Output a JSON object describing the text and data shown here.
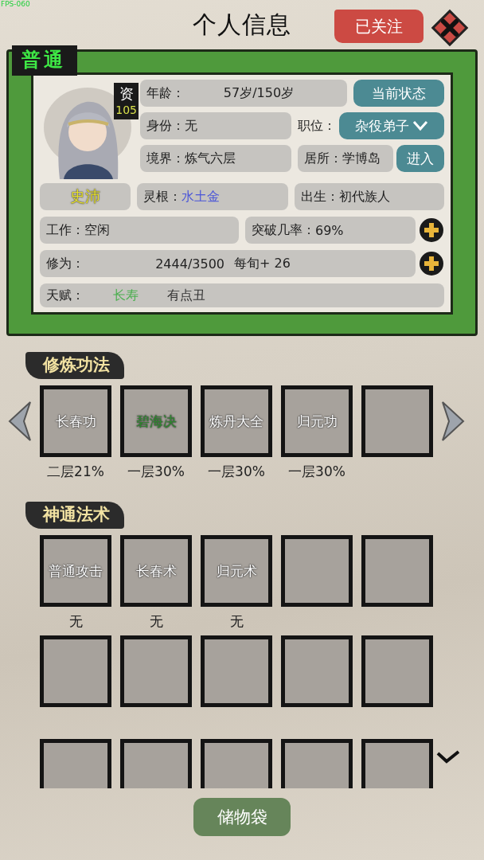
{
  "fps": "FPS-060",
  "title": "个人信息",
  "follow_button": "已关注",
  "rank": "普通",
  "aptitude": {
    "label": "资",
    "value": "105"
  },
  "name": "史沛",
  "age": {
    "label": "年龄：",
    "value": "57岁/150岁"
  },
  "status_button": "当前状态",
  "identity": {
    "label": "身份：",
    "value": "无"
  },
  "position": {
    "label": "职位：",
    "value": "杂役弟子"
  },
  "realm": {
    "label": "境界：",
    "value": "炼气六层"
  },
  "residence": {
    "label": "居所：",
    "value": "学博岛"
  },
  "enter_button": "进入",
  "spirit_root": {
    "label": "灵根：",
    "value": "水土金",
    "color": "#4a55d8"
  },
  "birth": {
    "label": "出生：",
    "value": "初代族人"
  },
  "work": {
    "label": "工作：",
    "value": "空闲"
  },
  "breakthrough": {
    "label": "突破几率：",
    "value": "69%"
  },
  "cultivation": {
    "label": "修为：",
    "value": "2444/3500",
    "rate": "每旬+ 26"
  },
  "talents": {
    "label": "天赋：",
    "items": [
      {
        "text": "长寿",
        "color": "#4caf50"
      },
      {
        "text": "有点丑",
        "color": "#333333"
      }
    ]
  },
  "methods": {
    "title": "修炼功法",
    "slots": [
      {
        "kind": "skill",
        "name": "长春功",
        "color": "#ffffff",
        "progress": "二层21%"
      },
      {
        "kind": "skill",
        "name": "碧海决",
        "color": "#2e8b2e",
        "progress": "一层30%"
      },
      {
        "kind": "skill",
        "name": "炼丹大全",
        "color": "#ffffff",
        "progress": "一层30%"
      },
      {
        "kind": "skill",
        "name": "归元功",
        "color": "#ffffff",
        "progress": "一层30%"
      },
      {
        "kind": "empty"
      }
    ]
  },
  "spells": {
    "title": "神通法术",
    "slots": [
      {
        "kind": "skill",
        "name": "普通攻击",
        "progress": "无"
      },
      {
        "kind": "skill",
        "name": "长春术",
        "progress": "无"
      },
      {
        "kind": "skill",
        "name": "归元术",
        "progress": "无"
      },
      {
        "kind": "empty"
      },
      {
        "kind": "empty"
      },
      {
        "kind": "empty"
      },
      {
        "kind": "empty"
      },
      {
        "kind": "empty"
      },
      {
        "kind": "empty"
      },
      {
        "kind": "empty"
      },
      {
        "kind": "empty"
      },
      {
        "kind": "empty"
      },
      {
        "kind": "empty"
      },
      {
        "kind": "empty"
      },
      {
        "kind": "empty"
      }
    ]
  },
  "storage_button": "储物袋"
}
